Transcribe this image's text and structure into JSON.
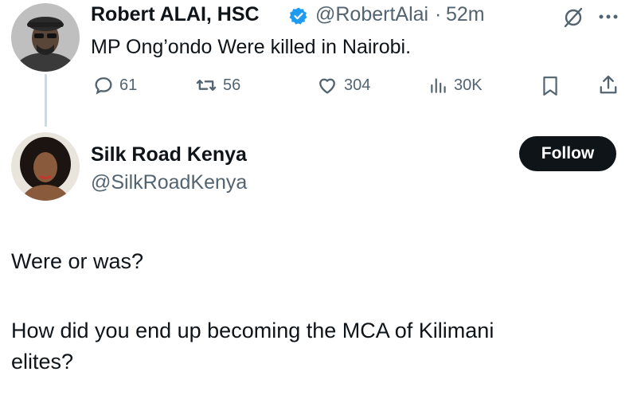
{
  "original_tweet": {
    "author_name": "Robert ALAI, HSC",
    "handle": "@RobertAlai",
    "separator": "·",
    "time": "52m",
    "text": "MP Ong’ondo Were killed in Nairobi.",
    "actions": {
      "replies": "61",
      "retweets": "56",
      "likes": "304",
      "views": "30K"
    }
  },
  "reply": {
    "author_name": "Silk Road Kenya",
    "handle": "@SilkRoadKenya",
    "follow_label": "Follow",
    "line1": "Were or was?",
    "line2": "How did you end up becoming the MCA of Kilimani",
    "line3": "elites?"
  },
  "colors": {
    "verified": "#1d9bf0",
    "muted": "#536471",
    "follow_bg": "#0f1419"
  },
  "icons": [
    "verified-badge-icon",
    "grok-icon",
    "more-icon",
    "reply-icon",
    "retweet-icon",
    "like-icon",
    "views-icon",
    "bookmark-icon",
    "share-icon"
  ]
}
